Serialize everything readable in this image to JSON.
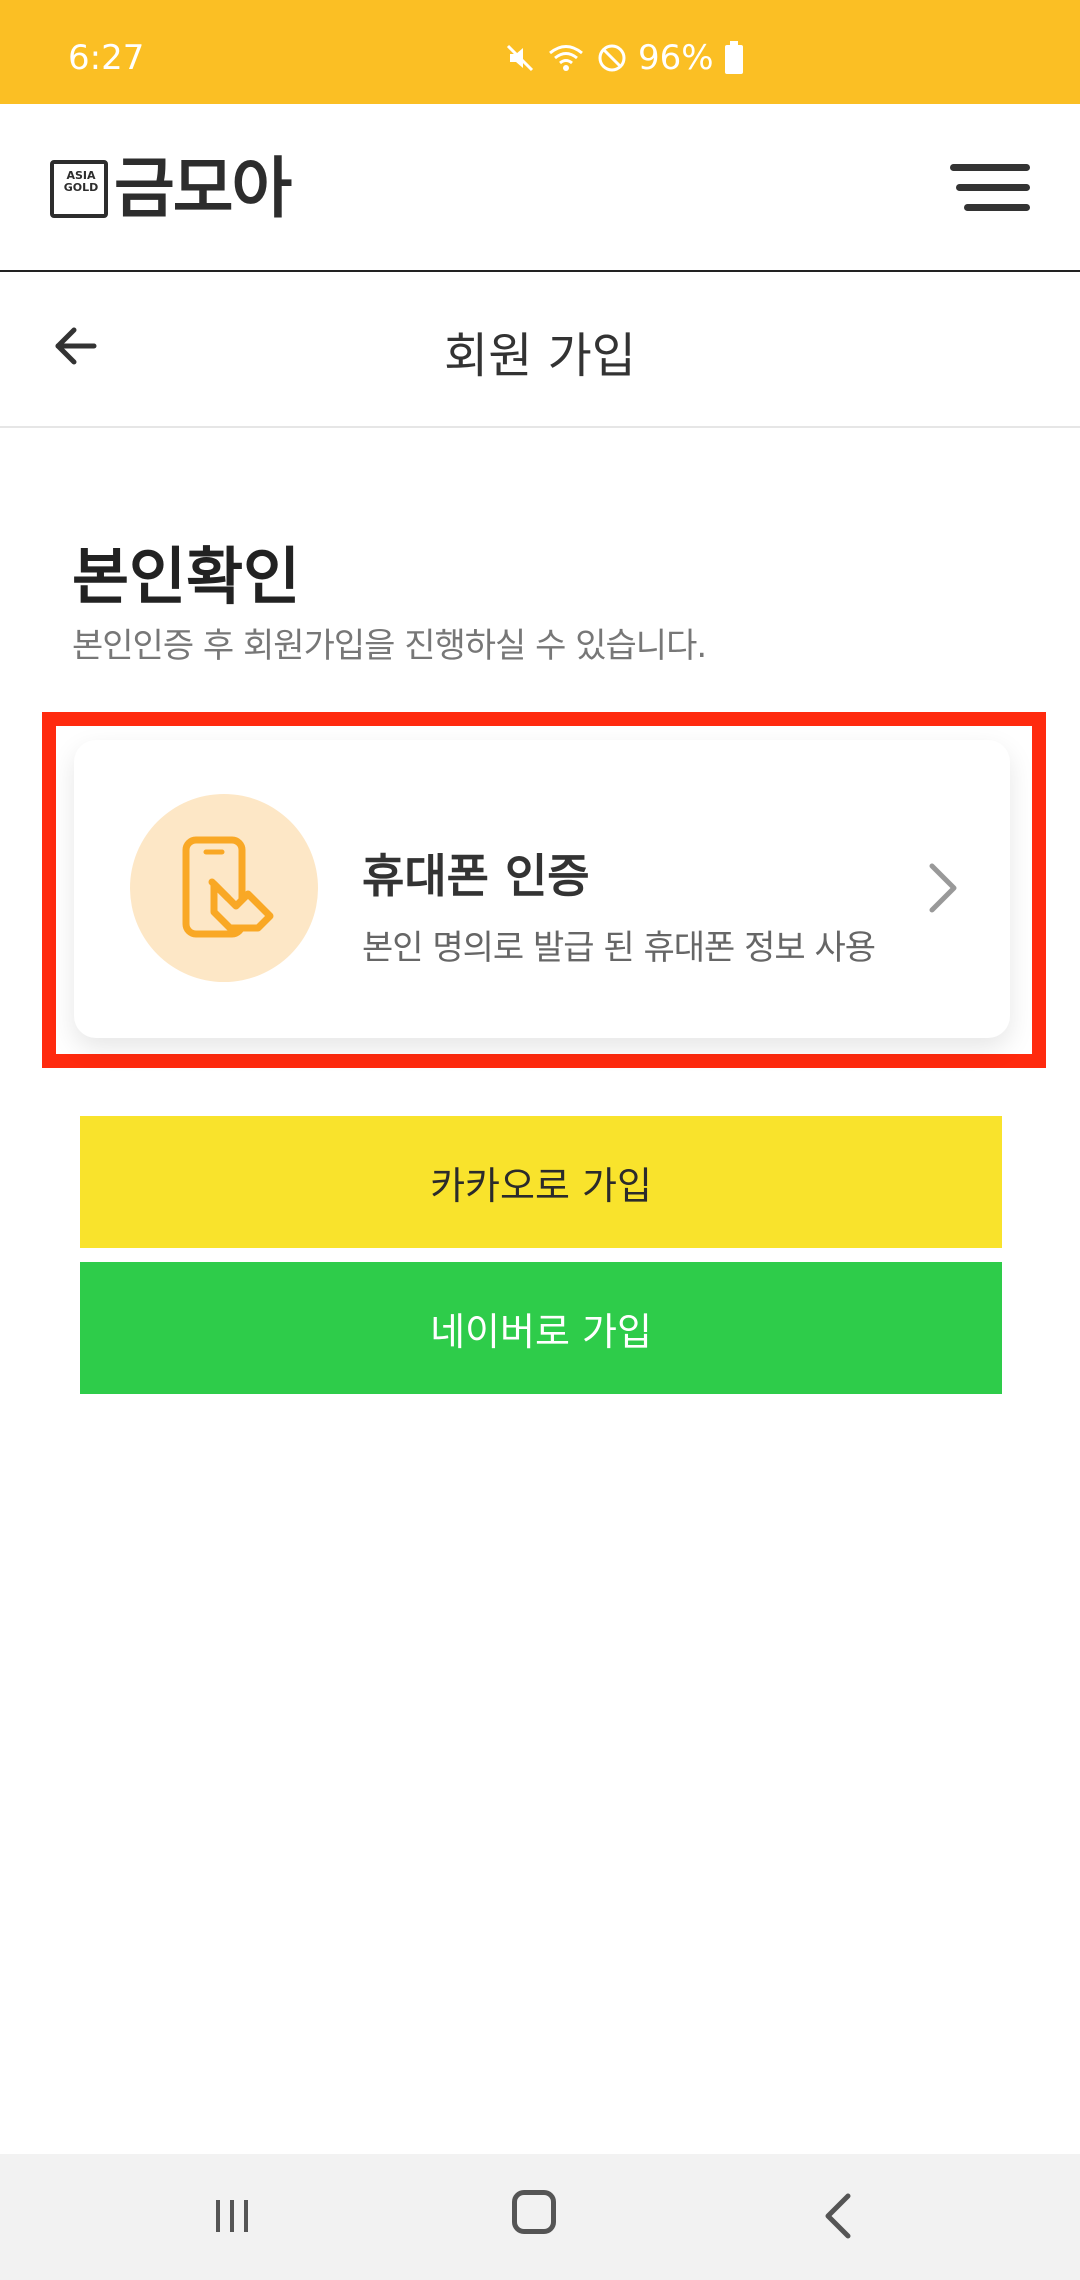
{
  "status_bar": {
    "time": "6:27",
    "battery_percent": "96%",
    "icons": [
      "mute-icon",
      "wifi-icon",
      "do-not-disturb-icon",
      "battery-icon"
    ]
  },
  "header": {
    "logo_badge_top": "ASIA",
    "logo_badge_bottom": "GOLD",
    "logo_text": "금모아",
    "menu_icon": "hamburger-menu-icon"
  },
  "subheader": {
    "back_icon": "arrow-left-icon",
    "title": "회원 가입"
  },
  "section": {
    "title": "본인확인",
    "description": "본인인증 후 회원가입을 진행하실 수 있습니다."
  },
  "phone_auth_card": {
    "icon": "phone-touch-icon",
    "title": "휴대폰 인증",
    "description": "본인 명의로 발급 된 휴대폰 정보 사용",
    "chevron_icon": "chevron-right-icon"
  },
  "buttons": {
    "kakao_label": "카카오로 가입",
    "naver_label": "네이버로 가입"
  },
  "colors": {
    "status_bar": "#fbbf24",
    "highlight_frame": "#ff2a0e",
    "kakao": "#f9e32c",
    "naver": "#2ecc4a",
    "icon_accent": "#f9a825"
  },
  "nav_bar": {
    "icons": [
      "recent-apps-icon",
      "home-icon",
      "back-icon"
    ]
  }
}
